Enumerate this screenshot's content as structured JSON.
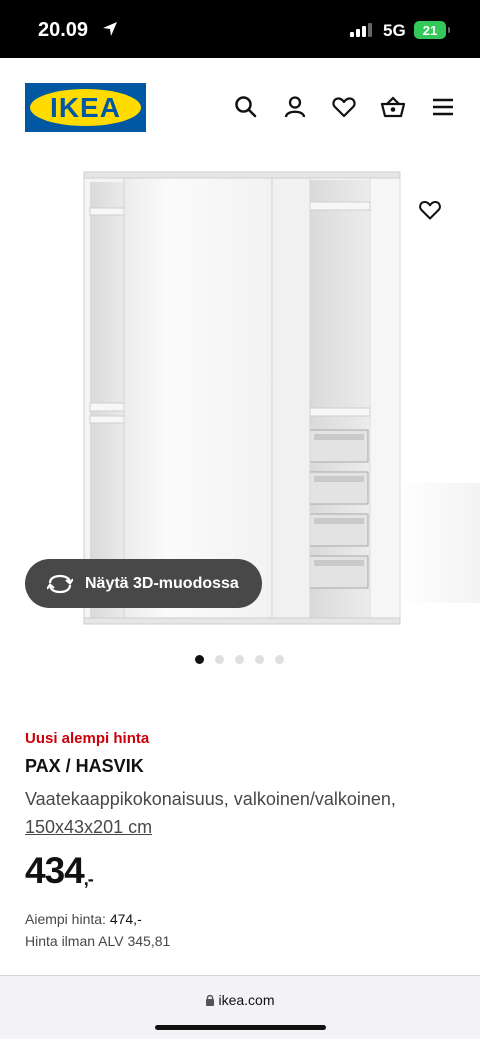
{
  "status": {
    "time": "20.09",
    "network": "5G",
    "battery": "21"
  },
  "header": {
    "logo_text": "IKEA",
    "icons": [
      "search-icon",
      "user-icon",
      "heart-icon",
      "basket-icon",
      "menu-icon"
    ]
  },
  "gallery": {
    "view3d_label": "Näytä 3D-muodossa",
    "image_count": 5,
    "active_index": 0
  },
  "product": {
    "badge": "Uusi alempi hinta",
    "name": "PAX / HASVIK",
    "description": "Vaatekaappikokonaisuus, valkoinen/valkoinen,",
    "size": "150x43x201 cm",
    "price": "434",
    "price_suffix": ",-",
    "previous_price_label": "Aiempi hinta:",
    "previous_price": "474,-",
    "vat_text": "Hinta ilman ALV 345,81"
  },
  "browser": {
    "url": "ikea.com"
  },
  "colors": {
    "brand_blue": "#0058a3",
    "brand_yellow": "#ffdb00",
    "sale_red": "#cc0008"
  }
}
